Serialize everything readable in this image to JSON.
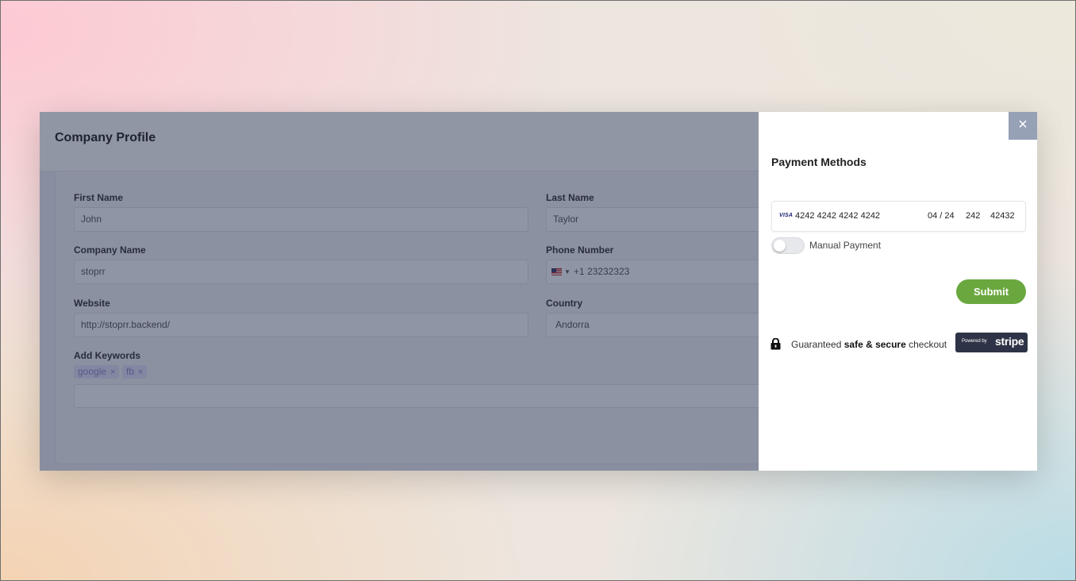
{
  "page": {
    "title": "Company Profile",
    "form": {
      "first_name": {
        "label": "First Name",
        "value": "John"
      },
      "last_name": {
        "label": "Last Name",
        "value": "Taylor"
      },
      "company_name": {
        "label": "Company Name",
        "value": "stoprr"
      },
      "phone_number": {
        "label": "Phone Number",
        "country_flag": "us-flag-icon",
        "value": "+1 23232323"
      },
      "website": {
        "label": "Website",
        "value": "http://stoprr.backend/"
      },
      "country": {
        "label": "Country",
        "value": "Andorra"
      },
      "keywords": {
        "label": "Add Keywords",
        "tags": [
          {
            "text": "google",
            "remove": "×"
          },
          {
            "text": "fb",
            "remove": "×"
          }
        ],
        "input_value": ""
      }
    }
  },
  "drawer": {
    "close_icon": "×",
    "title": "Payment Methods",
    "card": {
      "brand": "VISA",
      "number": "4242 4242 4242 4242",
      "expiry": "04 / 24",
      "cvc": "242",
      "zip": "42432"
    },
    "manual_payment": {
      "label": "Manual Payment",
      "enabled": false
    },
    "submit_label": "Submit",
    "secure": {
      "prefix": "Guaranteed ",
      "bold": "safe & secure",
      "suffix": " checkout"
    },
    "stripe": {
      "powered_by": "Powered by",
      "brand": "stripe"
    }
  },
  "colors": {
    "accent_green": "#6aa83f",
    "close_button": "#96a1b6",
    "overlay": "#1c2646",
    "tag_bg": "#e3e0f5",
    "stripe_badge": "#2f3347"
  }
}
